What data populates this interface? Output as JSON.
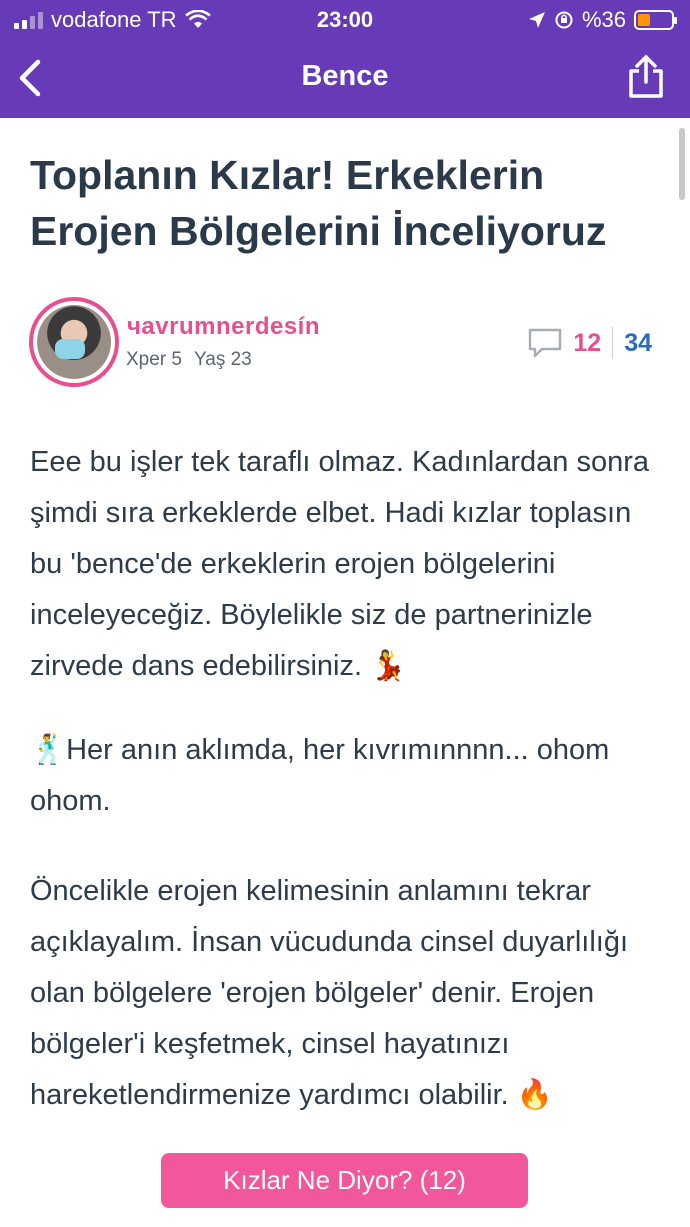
{
  "status_bar": {
    "carrier": "vodafone TR",
    "time": "23:00",
    "battery": "%36"
  },
  "nav": {
    "title": "Bence"
  },
  "article": {
    "title": "Toplanın Kızlar! Erkeklerin Erojen Bölgelerini İnceliyoruz",
    "author": {
      "name": "чavrumnerdesín",
      "level": "Xper 5",
      "age": "Yaş 23"
    },
    "stats": {
      "comments": "12",
      "views": "34"
    },
    "paragraphs": [
      "Eee bu işler tek taraflı olmaz. Kadınlardan sonra şimdi sıra erkeklerde elbet. Hadi kızlar toplasın bu 'bence'de erkeklerin erojen bölgelerini inceleyeceğiz. Böylelikle siz de partnerinizle zirvede dans edebilirsiniz.",
      "Her anın aklımda, her kıvrımınnnn... ohom ohom.",
      "Öncelikle erojen kelimesinin anlamını tekrar açıklayalım. İnsan vücudunda cinsel duyarlılığı olan bölgelere 'erojen bölgeler' denir. Erojen bölgeler'i keşfetmek, cinsel hayatınızı hareketlendirmenize yardımcı olabilir."
    ],
    "emojis": {
      "dancer": "💃",
      "man_dancing": "🕺",
      "fire": "🔥"
    }
  },
  "cta": {
    "label": "Kızlar Ne Diyor? (12)"
  },
  "colors": {
    "header": "#673ab7",
    "accent_pink": "#e84f8f",
    "cta_pink": "#f2579b",
    "views_blue": "#2a6bbf"
  },
  "icons": [
    "back-chevron-icon",
    "share-icon",
    "comment-icon",
    "wifi-icon",
    "location-icon",
    "orientation-lock-icon",
    "battery-icon"
  ]
}
